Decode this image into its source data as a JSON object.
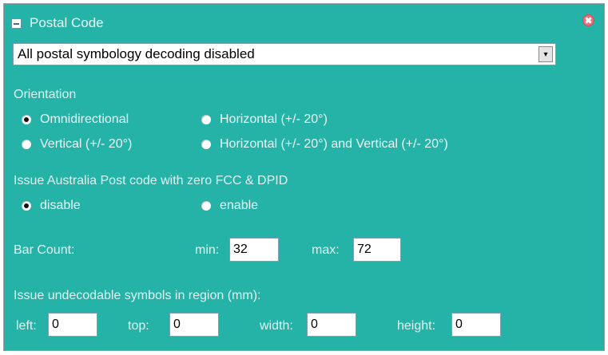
{
  "panel": {
    "title": "Postal Code",
    "collapse_icon": "collapse-minus-icon",
    "close_icon": "close-x-icon"
  },
  "symbology_select": {
    "value": "All postal symbology decoding disabled",
    "arrow": "▾"
  },
  "orientation": {
    "label": "Orientation",
    "options": [
      {
        "label": "Omnidirectional",
        "checked": true
      },
      {
        "label": "Horizontal (+/- 20°)",
        "checked": false
      },
      {
        "label": "Vertical (+/- 20°)",
        "checked": false
      },
      {
        "label": "Horizontal (+/- 20°) and Vertical (+/- 20°)",
        "checked": false
      }
    ]
  },
  "australia_post": {
    "label": "Issue Australia Post code with zero FCC & DPID",
    "options": [
      {
        "label": "disable",
        "checked": true
      },
      {
        "label": "enable",
        "checked": false
      }
    ]
  },
  "bar_count": {
    "label": "Bar Count:",
    "min_label": "min:",
    "min_value": "32",
    "max_label": "max:",
    "max_value": "72"
  },
  "region": {
    "label": "Issue undecodable symbols in region (mm):",
    "left_label": "left:",
    "left_value": "0",
    "top_label": "top:",
    "top_value": "0",
    "width_label": "width:",
    "width_value": "0",
    "height_label": "height:",
    "height_value": "0"
  },
  "colors": {
    "panel_bg": "#25b3a8",
    "label_text": "#dff3f1"
  }
}
